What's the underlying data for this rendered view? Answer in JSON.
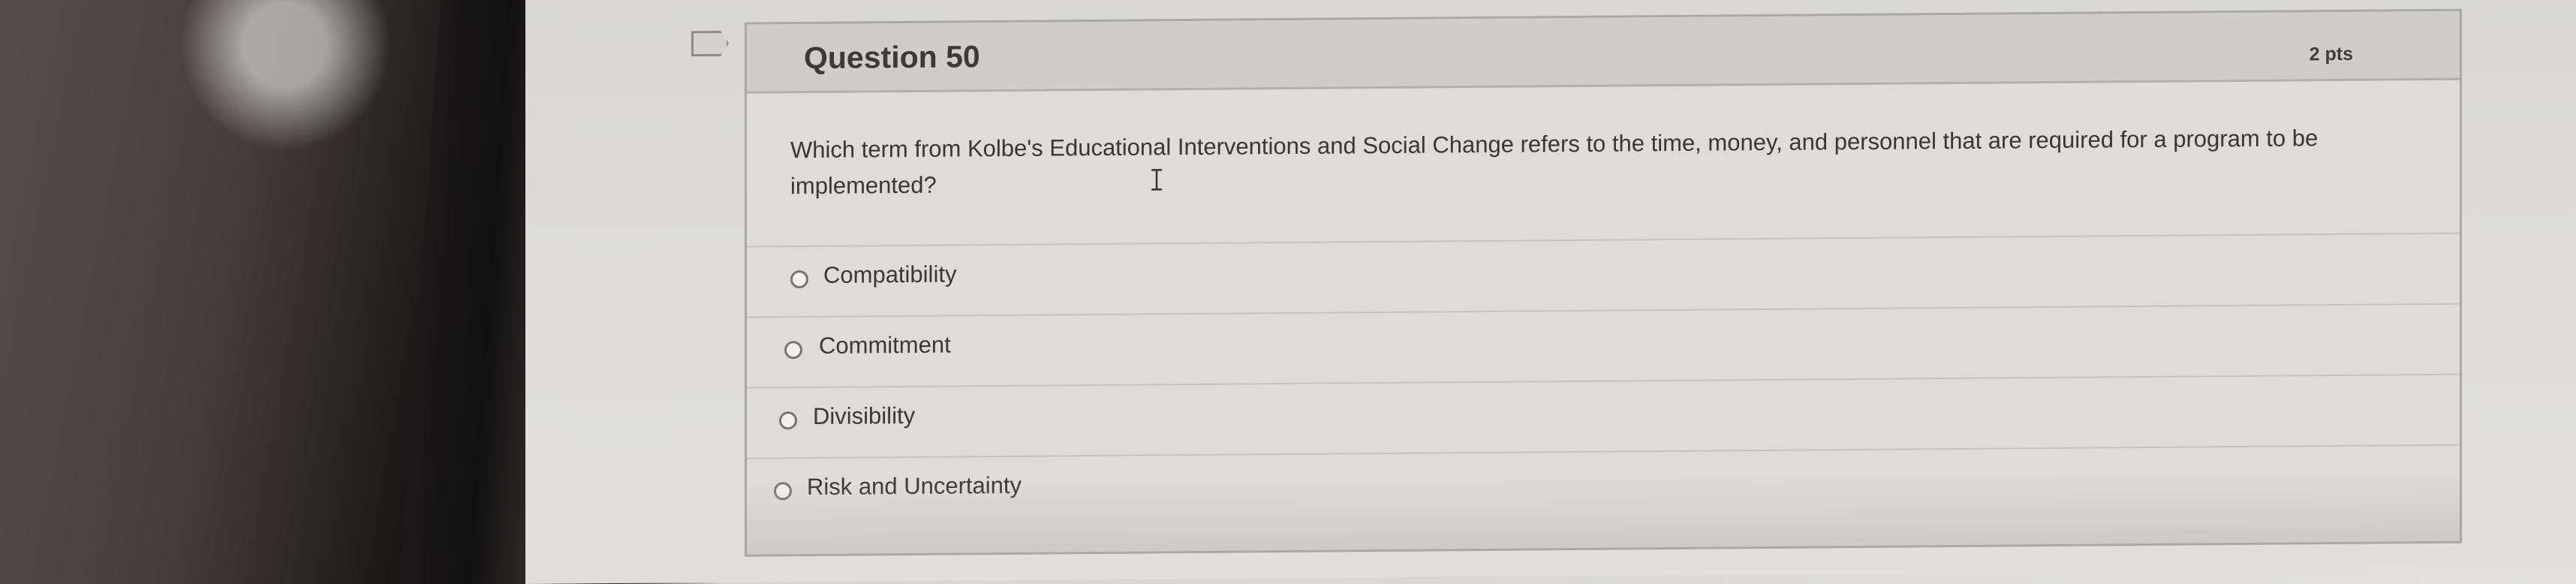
{
  "question": {
    "title": "Question 50",
    "points": "2 pts",
    "prompt": "Which term from Kolbe's Educational Interventions and Social Change refers to the time, money, and personnel that are required for a program to be implemented?"
  },
  "answers": [
    {
      "label": "Compatibility"
    },
    {
      "label": "Commitment"
    },
    {
      "label": "Divisibility"
    },
    {
      "label": "Risk and Uncertainty"
    }
  ],
  "icons": {
    "question-marker": "flag-tab-icon",
    "text-cursor": "i-beam-cursor-icon",
    "radio": "radio-button-icon"
  }
}
